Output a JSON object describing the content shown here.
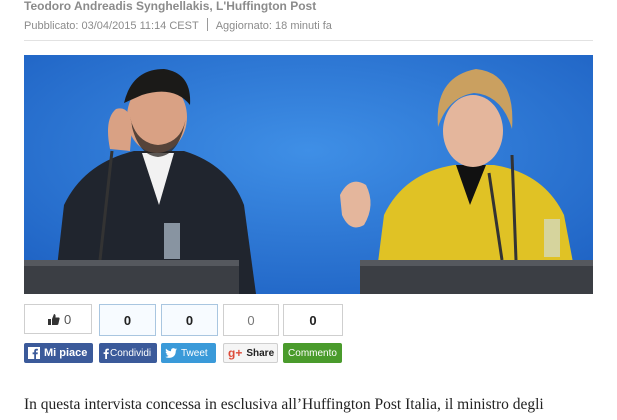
{
  "byline": "Teodoro Andreadis Synghellakis, L'Huffington Post",
  "meta": {
    "published": "Pubblicato: 03/04/2015 11:14 CEST",
    "updated": "Aggiornato: 18 minuti fa"
  },
  "counts": {
    "like": "0",
    "share": "0",
    "tweet": "0",
    "gplus": "0",
    "comment": "0"
  },
  "buttons": {
    "like": "Mi piace",
    "share": "Condividi",
    "tweet": "Tweet",
    "gplus": "Share",
    "comment": "Commento"
  },
  "article": {
    "text": "In questa intervista concessa in esclusiva all’Huffington Post Italia, il ministro degli"
  }
}
